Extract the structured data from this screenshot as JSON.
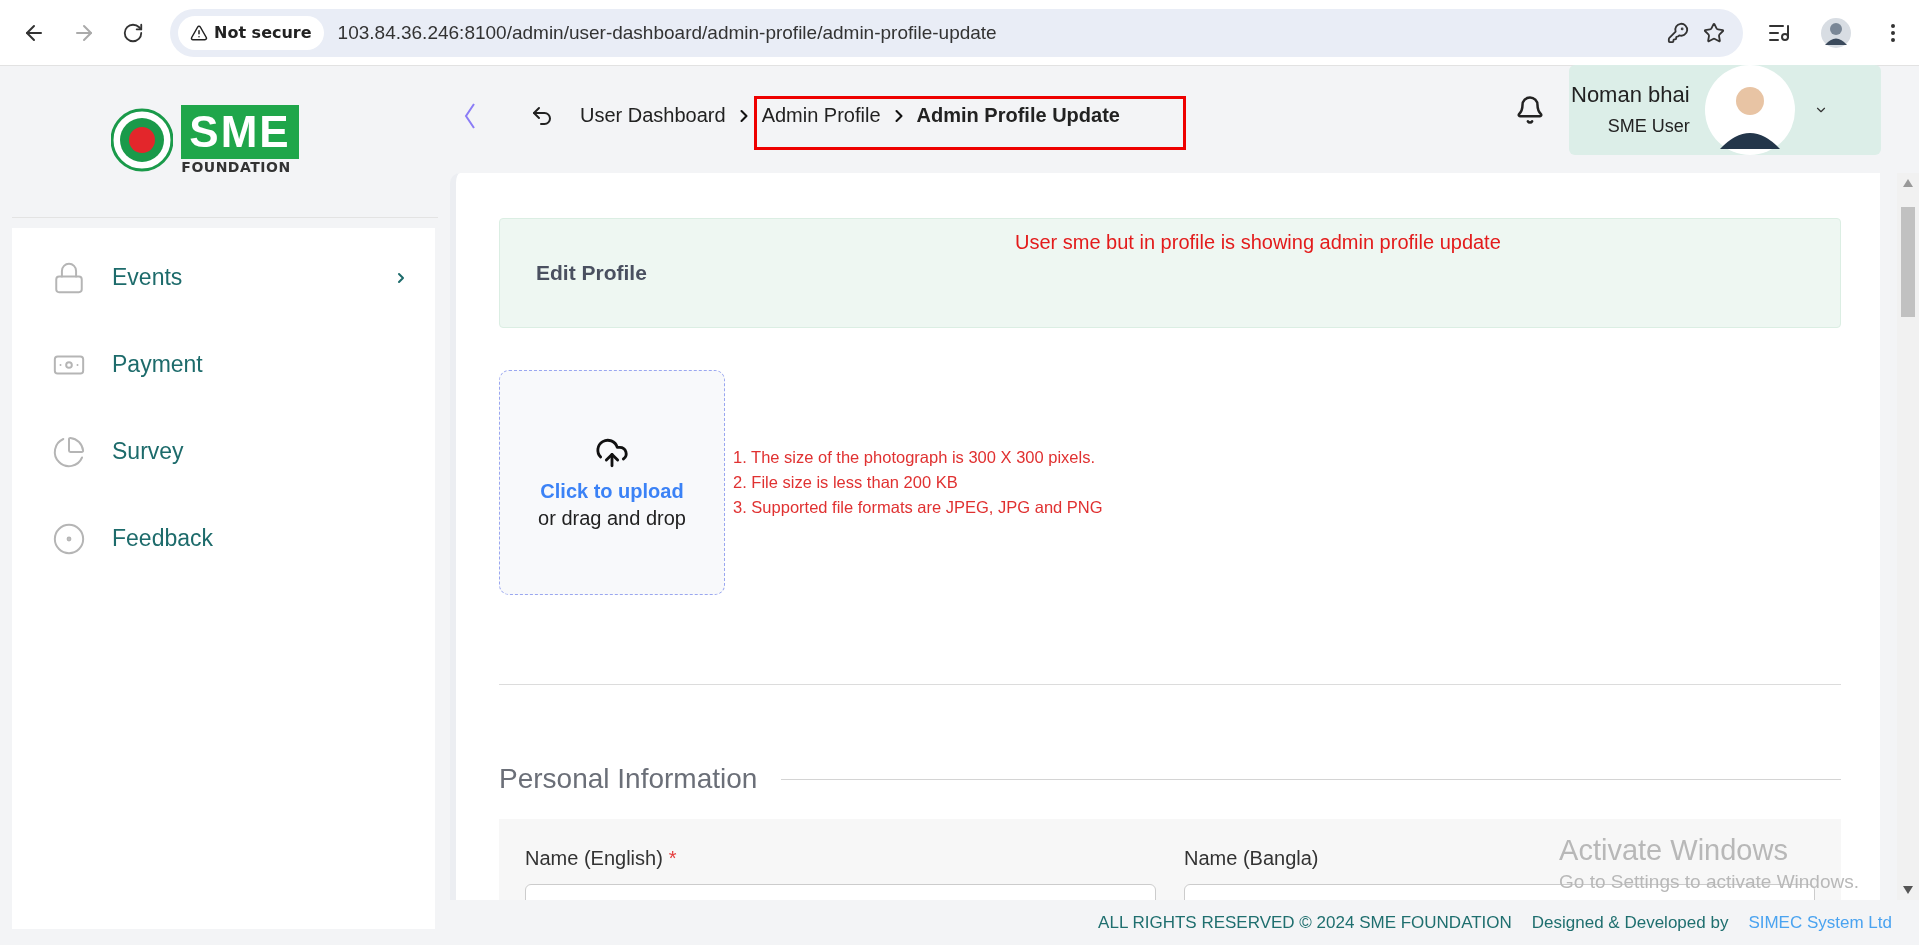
{
  "browser": {
    "security": "Not secure",
    "url": "103.84.36.246:8100/admin/user-dashboard/admin-profile/admin-profile-update"
  },
  "logo": {
    "mark": "SME",
    "subtitle": "FOUNDATION"
  },
  "sidebar": {
    "items": [
      {
        "label": "Events",
        "kind": "lock",
        "expandable": true
      },
      {
        "label": "Payment",
        "kind": "money",
        "expandable": false
      },
      {
        "label": "Survey",
        "kind": "pie",
        "expandable": false
      },
      {
        "label": "Feedback",
        "kind": "circles",
        "expandable": false
      }
    ]
  },
  "breadcrumb": [
    {
      "label": "User Dashboard",
      "current": false
    },
    {
      "label": "Admin Profile",
      "current": false
    },
    {
      "label": "Admin Profile Update",
      "current": true
    }
  ],
  "user": {
    "name": "Noman bhai",
    "role": "SME User"
  },
  "annotation": {
    "note": "User sme but in profile is showing admin profile update"
  },
  "page": {
    "title": "Edit Profile"
  },
  "upload": {
    "action": "Click to upload",
    "hint": "or drag and drop",
    "rules": [
      "1. The size of the photograph is 300 X 300 pixels.",
      "2. File size is less than 200 KB",
      "3. Supported file formats are JPEG, JPG and PNG"
    ]
  },
  "section": {
    "title": "Personal Information"
  },
  "required_mark": "*",
  "fields": [
    {
      "label": "Name (English)",
      "required": true
    },
    {
      "label": "Name (Bangla)",
      "required": false
    }
  ],
  "footer": {
    "copyright": "ALL RIGHTS RESERVED © 2024 SME FOUNDATION",
    "credit": "Designed & Developed by",
    "developer": "SIMEC System Ltd"
  },
  "os_overlay": {
    "title": "Activate Windows",
    "message": "Go to Settings to activate Windows."
  }
}
